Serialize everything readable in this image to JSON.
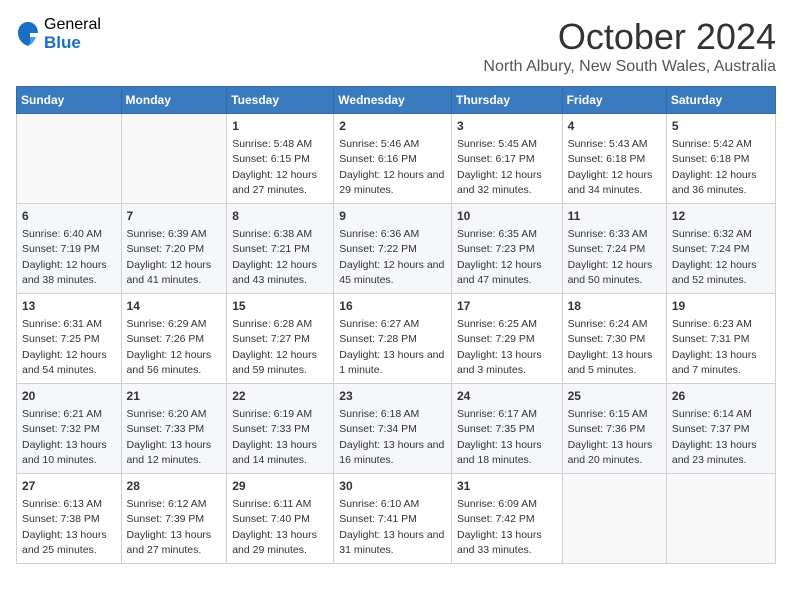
{
  "logo": {
    "general": "General",
    "blue": "Blue"
  },
  "header": {
    "month": "October 2024",
    "location": "North Albury, New South Wales, Australia"
  },
  "weekdays": [
    "Sunday",
    "Monday",
    "Tuesday",
    "Wednesday",
    "Thursday",
    "Friday",
    "Saturday"
  ],
  "weeks": [
    [
      {
        "day": "",
        "sunrise": "",
        "sunset": "",
        "daylight": ""
      },
      {
        "day": "",
        "sunrise": "",
        "sunset": "",
        "daylight": ""
      },
      {
        "day": "1",
        "sunrise": "Sunrise: 5:48 AM",
        "sunset": "Sunset: 6:15 PM",
        "daylight": "Daylight: 12 hours and 27 minutes."
      },
      {
        "day": "2",
        "sunrise": "Sunrise: 5:46 AM",
        "sunset": "Sunset: 6:16 PM",
        "daylight": "Daylight: 12 hours and 29 minutes."
      },
      {
        "day": "3",
        "sunrise": "Sunrise: 5:45 AM",
        "sunset": "Sunset: 6:17 PM",
        "daylight": "Daylight: 12 hours and 32 minutes."
      },
      {
        "day": "4",
        "sunrise": "Sunrise: 5:43 AM",
        "sunset": "Sunset: 6:18 PM",
        "daylight": "Daylight: 12 hours and 34 minutes."
      },
      {
        "day": "5",
        "sunrise": "Sunrise: 5:42 AM",
        "sunset": "Sunset: 6:18 PM",
        "daylight": "Daylight: 12 hours and 36 minutes."
      }
    ],
    [
      {
        "day": "6",
        "sunrise": "Sunrise: 6:40 AM",
        "sunset": "Sunset: 7:19 PM",
        "daylight": "Daylight: 12 hours and 38 minutes."
      },
      {
        "day": "7",
        "sunrise": "Sunrise: 6:39 AM",
        "sunset": "Sunset: 7:20 PM",
        "daylight": "Daylight: 12 hours and 41 minutes."
      },
      {
        "day": "8",
        "sunrise": "Sunrise: 6:38 AM",
        "sunset": "Sunset: 7:21 PM",
        "daylight": "Daylight: 12 hours and 43 minutes."
      },
      {
        "day": "9",
        "sunrise": "Sunrise: 6:36 AM",
        "sunset": "Sunset: 7:22 PM",
        "daylight": "Daylight: 12 hours and 45 minutes."
      },
      {
        "day": "10",
        "sunrise": "Sunrise: 6:35 AM",
        "sunset": "Sunset: 7:23 PM",
        "daylight": "Daylight: 12 hours and 47 minutes."
      },
      {
        "day": "11",
        "sunrise": "Sunrise: 6:33 AM",
        "sunset": "Sunset: 7:24 PM",
        "daylight": "Daylight: 12 hours and 50 minutes."
      },
      {
        "day": "12",
        "sunrise": "Sunrise: 6:32 AM",
        "sunset": "Sunset: 7:24 PM",
        "daylight": "Daylight: 12 hours and 52 minutes."
      }
    ],
    [
      {
        "day": "13",
        "sunrise": "Sunrise: 6:31 AM",
        "sunset": "Sunset: 7:25 PM",
        "daylight": "Daylight: 12 hours and 54 minutes."
      },
      {
        "day": "14",
        "sunrise": "Sunrise: 6:29 AM",
        "sunset": "Sunset: 7:26 PM",
        "daylight": "Daylight: 12 hours and 56 minutes."
      },
      {
        "day": "15",
        "sunrise": "Sunrise: 6:28 AM",
        "sunset": "Sunset: 7:27 PM",
        "daylight": "Daylight: 12 hours and 59 minutes."
      },
      {
        "day": "16",
        "sunrise": "Sunrise: 6:27 AM",
        "sunset": "Sunset: 7:28 PM",
        "daylight": "Daylight: 13 hours and 1 minute."
      },
      {
        "day": "17",
        "sunrise": "Sunrise: 6:25 AM",
        "sunset": "Sunset: 7:29 PM",
        "daylight": "Daylight: 13 hours and 3 minutes."
      },
      {
        "day": "18",
        "sunrise": "Sunrise: 6:24 AM",
        "sunset": "Sunset: 7:30 PM",
        "daylight": "Daylight: 13 hours and 5 minutes."
      },
      {
        "day": "19",
        "sunrise": "Sunrise: 6:23 AM",
        "sunset": "Sunset: 7:31 PM",
        "daylight": "Daylight: 13 hours and 7 minutes."
      }
    ],
    [
      {
        "day": "20",
        "sunrise": "Sunrise: 6:21 AM",
        "sunset": "Sunset: 7:32 PM",
        "daylight": "Daylight: 13 hours and 10 minutes."
      },
      {
        "day": "21",
        "sunrise": "Sunrise: 6:20 AM",
        "sunset": "Sunset: 7:33 PM",
        "daylight": "Daylight: 13 hours and 12 minutes."
      },
      {
        "day": "22",
        "sunrise": "Sunrise: 6:19 AM",
        "sunset": "Sunset: 7:33 PM",
        "daylight": "Daylight: 13 hours and 14 minutes."
      },
      {
        "day": "23",
        "sunrise": "Sunrise: 6:18 AM",
        "sunset": "Sunset: 7:34 PM",
        "daylight": "Daylight: 13 hours and 16 minutes."
      },
      {
        "day": "24",
        "sunrise": "Sunrise: 6:17 AM",
        "sunset": "Sunset: 7:35 PM",
        "daylight": "Daylight: 13 hours and 18 minutes."
      },
      {
        "day": "25",
        "sunrise": "Sunrise: 6:15 AM",
        "sunset": "Sunset: 7:36 PM",
        "daylight": "Daylight: 13 hours and 20 minutes."
      },
      {
        "day": "26",
        "sunrise": "Sunrise: 6:14 AM",
        "sunset": "Sunset: 7:37 PM",
        "daylight": "Daylight: 13 hours and 23 minutes."
      }
    ],
    [
      {
        "day": "27",
        "sunrise": "Sunrise: 6:13 AM",
        "sunset": "Sunset: 7:38 PM",
        "daylight": "Daylight: 13 hours and 25 minutes."
      },
      {
        "day": "28",
        "sunrise": "Sunrise: 6:12 AM",
        "sunset": "Sunset: 7:39 PM",
        "daylight": "Daylight: 13 hours and 27 minutes."
      },
      {
        "day": "29",
        "sunrise": "Sunrise: 6:11 AM",
        "sunset": "Sunset: 7:40 PM",
        "daylight": "Daylight: 13 hours and 29 minutes."
      },
      {
        "day": "30",
        "sunrise": "Sunrise: 6:10 AM",
        "sunset": "Sunset: 7:41 PM",
        "daylight": "Daylight: 13 hours and 31 minutes."
      },
      {
        "day": "31",
        "sunrise": "Sunrise: 6:09 AM",
        "sunset": "Sunset: 7:42 PM",
        "daylight": "Daylight: 13 hours and 33 minutes."
      },
      {
        "day": "",
        "sunrise": "",
        "sunset": "",
        "daylight": ""
      },
      {
        "day": "",
        "sunrise": "",
        "sunset": "",
        "daylight": ""
      }
    ]
  ]
}
